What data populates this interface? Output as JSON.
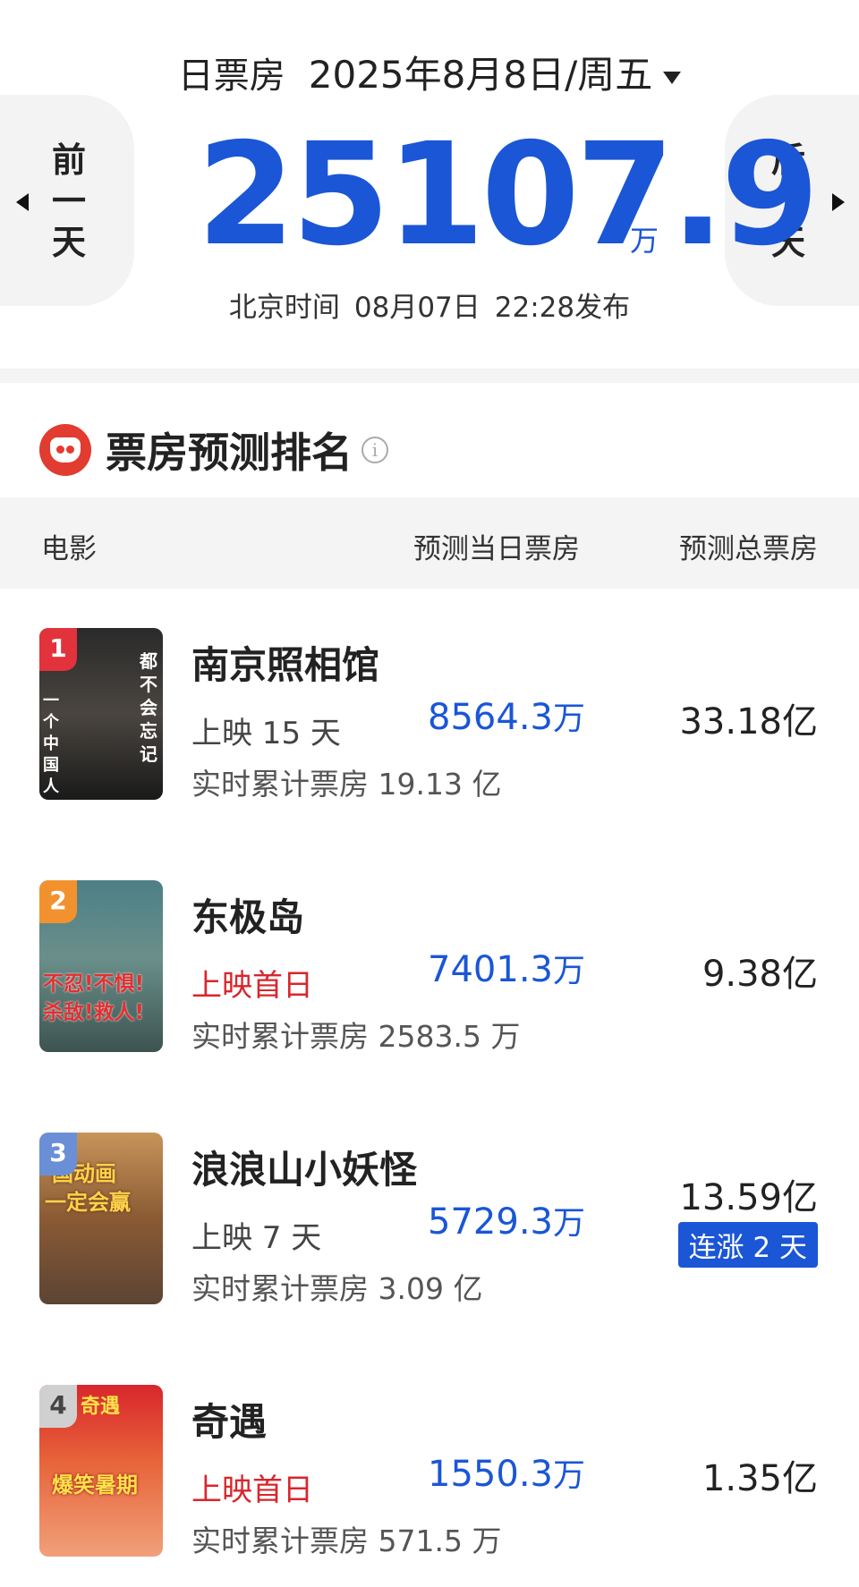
{
  "header": {
    "label": "日票房",
    "date": "2025年8月8日/周五",
    "prev_day": [
      "前",
      "一",
      "天"
    ],
    "next_day": [
      "后",
      "一",
      "天"
    ],
    "total": "25107.9",
    "unit": "万",
    "publish_prefix": "北京时间",
    "publish_date": "08月07日",
    "publish_time": "22:28发布"
  },
  "section": {
    "title": "票房预测排名",
    "info": "i"
  },
  "table_header": {
    "movie": "电影",
    "today": "预测当日票房",
    "total": "预测总票房"
  },
  "movies": [
    {
      "rank": "1",
      "title": "南京照相馆",
      "days": "上映 15 天",
      "days_style": "normal",
      "cum": "实时累计票房 19.13 亿",
      "today": "8564.3",
      "today_unit": "万",
      "total": "33.18亿",
      "badge": "",
      "poster_text": [
        "都不会忘记",
        "一个中国人"
      ],
      "rank_color": "#e2323b"
    },
    {
      "rank": "2",
      "title": "东极岛",
      "days": "上映首日",
      "days_style": "red",
      "cum": "实时累计票房 2583.5 万",
      "today": "7401.3",
      "today_unit": "万",
      "total": "9.38亿",
      "badge": "",
      "poster_text": [
        "不忍!不惧!",
        "杀敌!救人!"
      ],
      "rank_color": "#f2922e"
    },
    {
      "rank": "3",
      "title": "浪浪山小妖怪",
      "days": "上映 7 天",
      "days_style": "normal",
      "cum": "实时累计票房 3.09 亿",
      "today": "5729.3",
      "today_unit": "万",
      "total": "13.59亿",
      "badge": "连涨 2 天",
      "poster_text": [
        "国动画",
        "一定会赢"
      ],
      "rank_color": "#6b8fd6"
    },
    {
      "rank": "4",
      "title": "奇遇",
      "days": "上映首日",
      "days_style": "red",
      "cum": "实时累计票房 571.5 万",
      "today": "1550.3",
      "today_unit": "万",
      "total": "1.35亿",
      "badge": "",
      "poster_text": [
        "奇遇",
        "爆笑暑期"
      ],
      "rank_color": "#b5b5b5"
    }
  ]
}
